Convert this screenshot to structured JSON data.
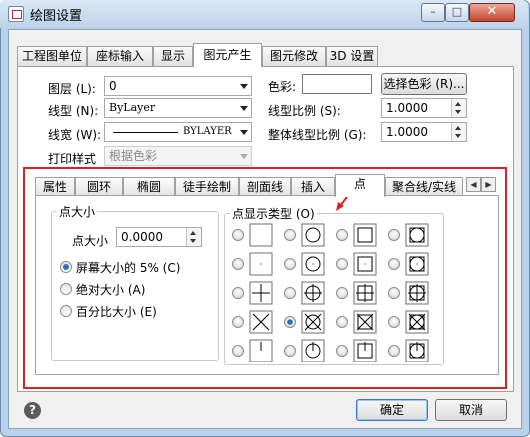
{
  "window": {
    "title": "绘图设置",
    "min_label": "–",
    "max_label": "□",
    "close_label": "✕"
  },
  "top_tabs": [
    "工程图单位",
    "座标输入",
    "显示",
    "图元产生",
    "图元修改",
    "3D 设置"
  ],
  "fields": {
    "layer_label": "图层 (L):",
    "layer_value": "0",
    "linetype_label": "线型 (N):",
    "linetype_value": "ByLayer",
    "lineweight_label": "线宽 (W):",
    "lineweight_value": "BYLAYER",
    "plotstyle_label": "打印样式",
    "plotstyle_value": "根据色彩",
    "color_label": "色彩:",
    "color_button": "选择色彩 (R)...",
    "ltscale_label": "线型比例 (S):",
    "ltscale_value": "1.0000",
    "global_ltscale_label": "整体线型比例 (G):",
    "global_ltscale_value": "1.0000"
  },
  "inner_tabs": [
    "属性",
    "圆环",
    "椭圆",
    "徒手绘制",
    "剖面线",
    "插入",
    "点",
    "聚合线/实线"
  ],
  "point_size": {
    "group_title": "点大小",
    "size_label": "点大小",
    "size_value": "0.0000",
    "options": [
      "屏幕大小的 5% (C)",
      "绝对大小 (A)",
      "百分比大小 (E)"
    ]
  },
  "point_type": {
    "group_title": "点显示类型 (O)",
    "selected": "row4-col2"
  },
  "buttons": {
    "ok": "确定",
    "cancel": "取消",
    "help": "?"
  }
}
